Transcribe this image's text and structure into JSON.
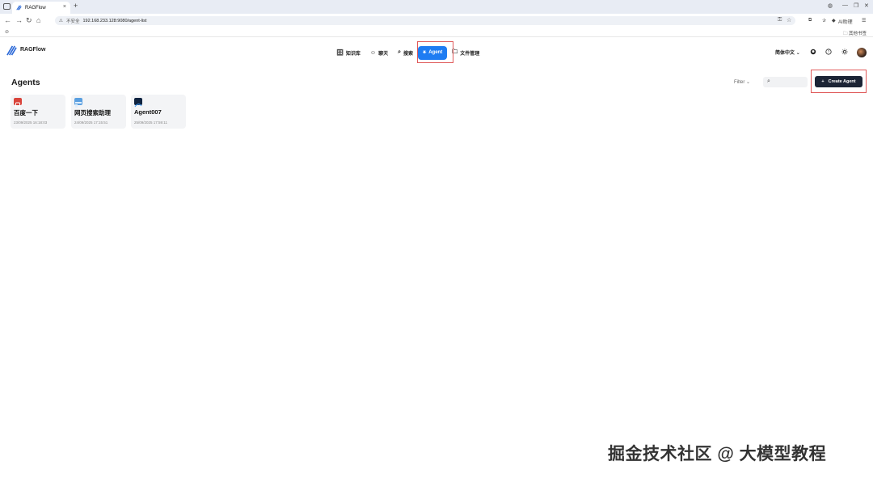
{
  "browser": {
    "tab_title": "RAGFlow",
    "tab_close": "×",
    "new_tab": "+",
    "url": "192.168.233.128:9080/agent-list",
    "insecure_label": "不安全",
    "ext_label": "AI助理",
    "bookmarks_right": "其他书签"
  },
  "app": {
    "name": "RAGFlow",
    "nav": [
      {
        "label": "知识库",
        "icon": "🗄"
      },
      {
        "label": "聊天",
        "icon": "☺"
      },
      {
        "label": "搜索",
        "icon": "⌕"
      },
      {
        "label": "Agent",
        "icon": "⚹"
      },
      {
        "label": "文件管理",
        "icon": "🗀"
      }
    ],
    "language": "简体中文",
    "colors": {
      "accent": "#1f7cf2",
      "dark_button": "#1c2435",
      "highlight": "#e05a5a"
    }
  },
  "main": {
    "title": "Agents",
    "filter_label": "Filter",
    "create_label": "Create Agent",
    "agents": [
      {
        "name": "百度一下",
        "date": "23/09/2025 16:18:03"
      },
      {
        "name": "网页搜索助理",
        "date": "24/09/2025 17:15:51"
      },
      {
        "name": "Agent007",
        "date": "25/09/2025 17:59:11"
      }
    ]
  },
  "watermark": "掘金技术社区 @ 大模型教程"
}
